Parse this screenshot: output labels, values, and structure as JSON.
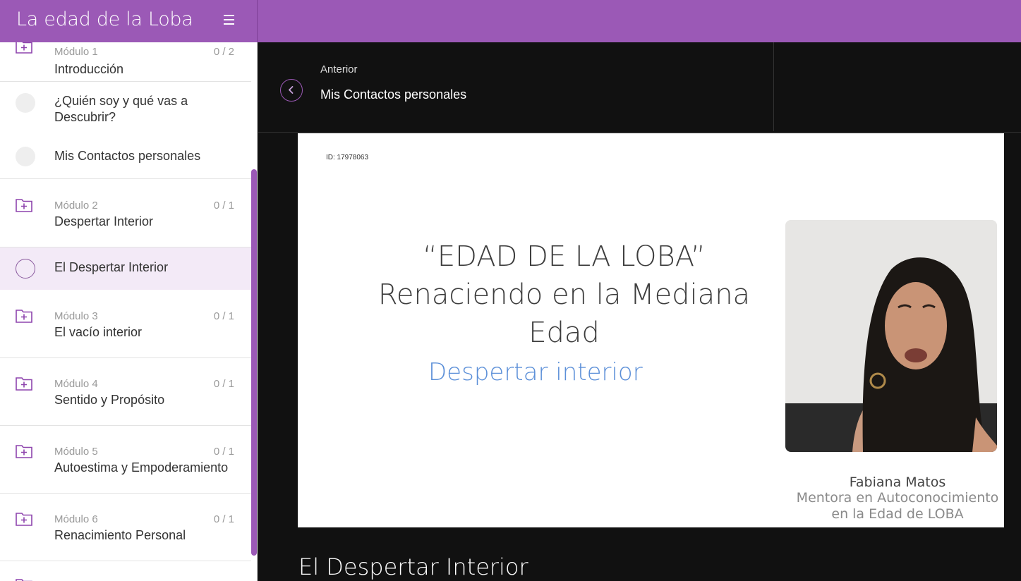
{
  "app": {
    "title": "La edad de la Loba"
  },
  "sidebar": {
    "modules": [
      {
        "label": "Módulo 1",
        "title": "Introducción",
        "count": "0 / 2"
      },
      {
        "label": "Módulo 2",
        "title": "Despertar Interior",
        "count": "0 / 1"
      },
      {
        "label": "Módulo 3",
        "title": "El vacío interior",
        "count": "0 / 1"
      },
      {
        "label": "Módulo 4",
        "title": "Sentido y Propósito",
        "count": "0 / 1"
      },
      {
        "label": "Módulo 5",
        "title": "Autoestima y Empoderamiento",
        "count": "0 / 1"
      },
      {
        "label": "Módulo 6",
        "title": "Renacimiento Personal",
        "count": "0 / 1"
      }
    ],
    "lessons": [
      {
        "title": "¿Quién soy y qué vas a Descubrir?"
      },
      {
        "title": "Mis Contactos personales"
      },
      {
        "title": "El Despertar Interior"
      }
    ]
  },
  "nav": {
    "prev_label": "Anterior",
    "prev_title": "Mis Contactos personales"
  },
  "slide": {
    "id_text": "ID: 17978063",
    "title_line1": "“EDAD DE LA LOBA”",
    "title_line2": "Renaciendo en la Mediana",
    "title_line3": "Edad",
    "subtitle": "Despertar interior",
    "presenter_name": "Fabiana Matos",
    "presenter_role_line1": "Mentora en Autoconocimiento",
    "presenter_role_line2": "en la Edad de LOBA"
  },
  "lesson": {
    "heading": "El Despertar Interior"
  },
  "colors": {
    "accent": "#9b59b6",
    "sidebar_active": "#f3eaf7",
    "main_bg": "#111111"
  }
}
